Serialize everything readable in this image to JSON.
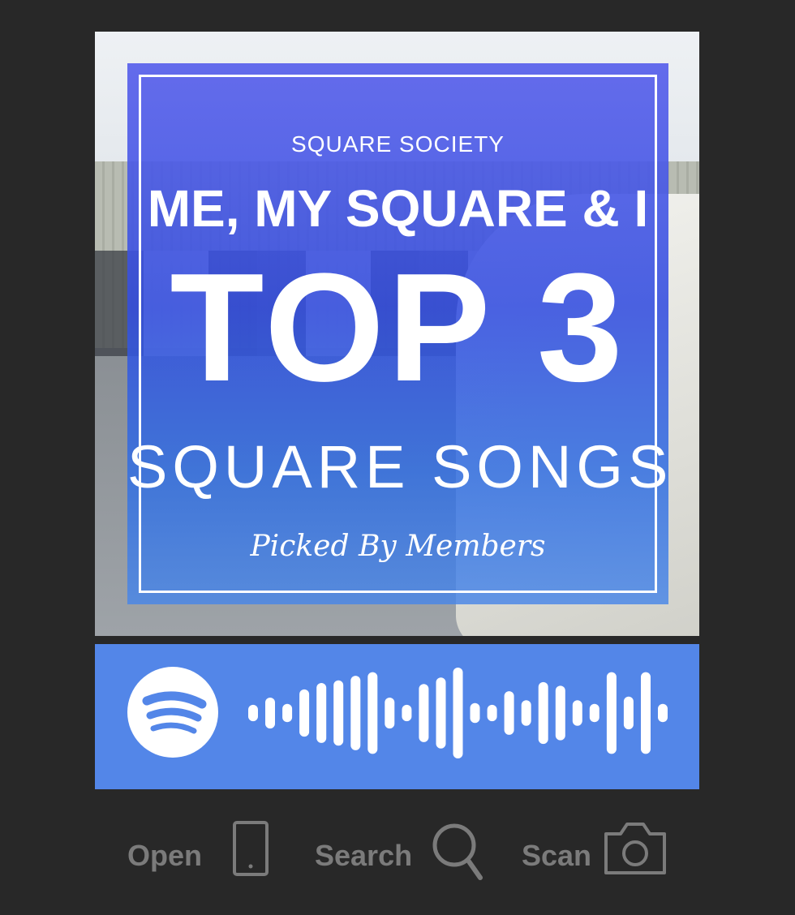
{
  "cover": {
    "society": "SQUARE SOCIETY",
    "subtitle": "ME, MY SQUARE & I",
    "headline": "TOP 3",
    "tagline": "SQUARE SONGS",
    "credit": "Picked By Members"
  },
  "code": {
    "logo_icon": "spotify-icon",
    "bar_heights": [
      0.18,
      0.34,
      0.2,
      0.52,
      0.66,
      0.72,
      0.82,
      0.9,
      0.34,
      0.18,
      0.64,
      0.78,
      1.0,
      0.22,
      0.18,
      0.48,
      0.28,
      0.68,
      0.6,
      0.28,
      0.2,
      0.9,
      0.36,
      0.9,
      0.2
    ],
    "color": "#5386e8"
  },
  "actions": [
    {
      "label": "Open",
      "icon": "phone-icon"
    },
    {
      "label": "Search",
      "icon": "search-icon"
    },
    {
      "label": "Scan",
      "icon": "camera-icon"
    }
  ],
  "colors": {
    "background": "#282828",
    "overlay": "#4a5ee6",
    "action_text": "#7b7b7b"
  }
}
